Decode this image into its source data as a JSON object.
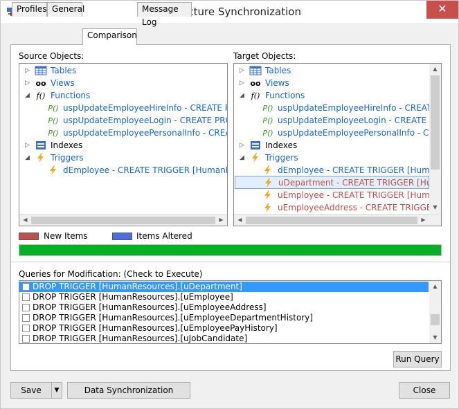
{
  "window": {
    "title": "* Structure Synchronization",
    "close_glyph": "✕"
  },
  "tabs": [
    {
      "label": "Profiles"
    },
    {
      "label": "General"
    },
    {
      "label": "Comparison"
    },
    {
      "label": "Message Log"
    }
  ],
  "source": {
    "label": "Source Objects:",
    "rows": [
      {
        "text": "Tables",
        "icon": "table-icon"
      },
      {
        "text": "Views",
        "icon": "glasses-icon"
      },
      {
        "text": "Functions",
        "icon": "function-icon"
      },
      {
        "text": "uspUpdateEmployeeHireInfo - CREATE PROC",
        "icon": "procedure-icon"
      },
      {
        "text": "uspUpdateEmployeeLogin - CREATE PROCED",
        "icon": "procedure-icon"
      },
      {
        "text": "uspUpdateEmployeePersonalInfo - CREATE P",
        "icon": "procedure-icon"
      },
      {
        "text": "Indexes",
        "icon": "index-icon"
      },
      {
        "text": "Triggers",
        "icon": "trigger-icon"
      },
      {
        "text": "dEmployee - CREATE TRIGGER [HumanResou",
        "icon": "trigger-icon"
      }
    ]
  },
  "target": {
    "label": "Target Objects:",
    "rows": [
      {
        "text": "Tables",
        "icon": "table-icon"
      },
      {
        "text": "Views",
        "icon": "glasses-icon"
      },
      {
        "text": "Functions",
        "icon": "function-icon"
      },
      {
        "text": "uspUpdateEmployeeHireInfo - CREATE PI",
        "icon": "procedure-icon"
      },
      {
        "text": "uspUpdateEmployeeLogin - CREATE PRO",
        "icon": "procedure-icon"
      },
      {
        "text": "uspUpdateEmployeePersonalInfo - CREA",
        "icon": "procedure-icon"
      },
      {
        "text": "Indexes",
        "icon": "index-icon"
      },
      {
        "text": "Triggers",
        "icon": "trigger-icon"
      },
      {
        "text": "dEmployee - CREATE TRIGGER [HumanRe",
        "icon": "trigger-icon"
      },
      {
        "text": "uDepartment - CREATE TRIGGER [Human",
        "icon": "trigger-icon"
      },
      {
        "text": "uEmployee - CREATE TRIGGER [HumanRe",
        "icon": "trigger-icon"
      },
      {
        "text": "uEmployeeAddress - CREATE TRIGGER [H",
        "icon": "trigger-icon"
      }
    ]
  },
  "legend": {
    "new_items": "New Items",
    "items_altered": "Items Altered",
    "new_color": "#c0504d",
    "altered_color": "#4a6fe3"
  },
  "progress": {
    "value": 1.0,
    "color": "#06b025"
  },
  "queries": {
    "label": "Queries for Modification: (Check to Execute)",
    "items": [
      {
        "text": "DROP TRIGGER [HumanResources].[uDepartment]",
        "checked": false,
        "selected": true
      },
      {
        "text": "DROP TRIGGER [HumanResources].[uEmployee]",
        "checked": false,
        "selected": false
      },
      {
        "text": "DROP TRIGGER [HumanResources].[uEmployeeAddress]",
        "checked": false,
        "selected": false
      },
      {
        "text": "DROP TRIGGER [HumanResources].[uEmployeeDepartmentHistory]",
        "checked": false,
        "selected": false
      },
      {
        "text": "DROP TRIGGER [HumanResources].[uEmployeePayHistory]",
        "checked": false,
        "selected": false
      },
      {
        "text": "DROP TRIGGER [HumanResources].[uJobCandidate]",
        "checked": false,
        "selected": false
      }
    ]
  },
  "buttons": {
    "run_query": "Run Query",
    "save": "Save",
    "data_sync": "Data Synchronization",
    "close": "Close"
  }
}
